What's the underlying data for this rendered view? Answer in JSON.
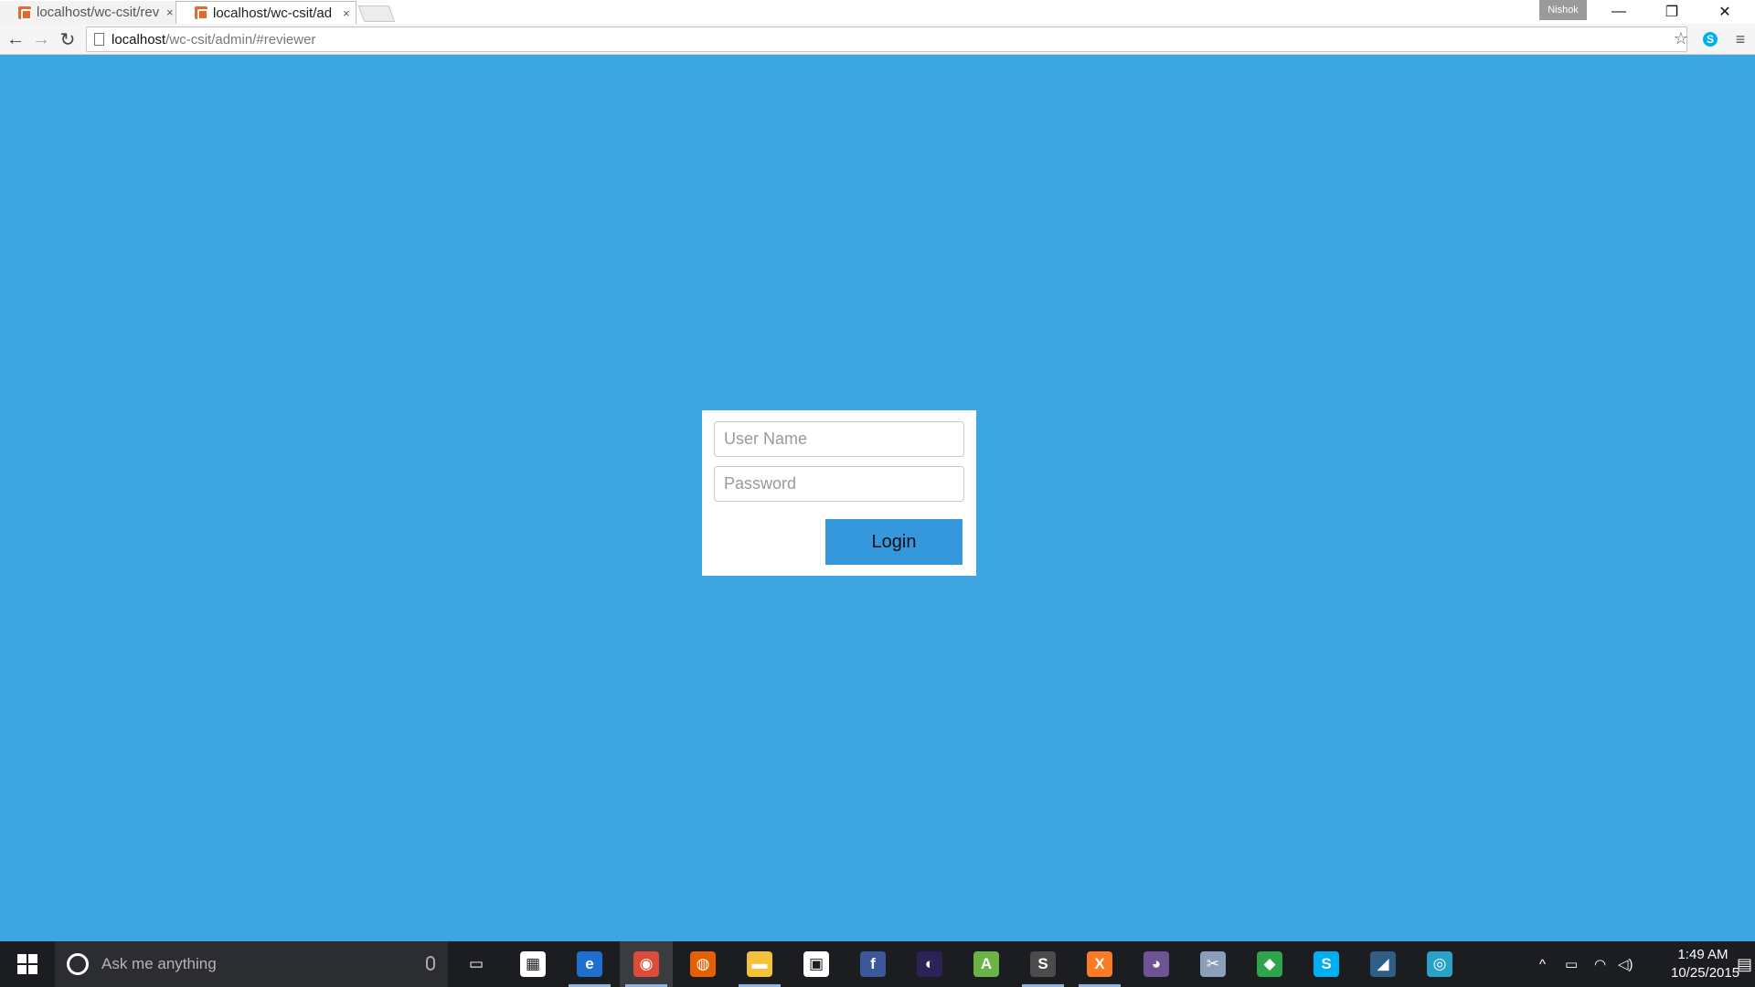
{
  "browser": {
    "tabs": [
      {
        "title": "localhost/wc-csit/rev",
        "active": false
      },
      {
        "title": "localhost/wc-csit/ad",
        "active": true
      }
    ],
    "tab_close_glyph": "×",
    "profile_name": "Nishok",
    "window_controls": {
      "minimize": "—",
      "restore": "❐",
      "close": "✕"
    },
    "url_host": "localhost",
    "url_path": "/wc-csit/admin/#reviewer",
    "nav": {
      "back": "←",
      "forward": "→",
      "reload": "↻"
    },
    "toolbar_glyphs": {
      "star": "☆",
      "skype": "S",
      "menu": "≡"
    }
  },
  "login": {
    "username_placeholder": "User Name",
    "password_placeholder": "Password",
    "button_label": "Login"
  },
  "colors": {
    "page_background": "#3ca5e2",
    "button_background": "#3598dc",
    "taskbar": "#1b1d21"
  },
  "taskbar": {
    "search_placeholder": "Ask me anything",
    "pinned": [
      {
        "name": "task-view",
        "glyph": "▭",
        "color": "#1b1d21"
      },
      {
        "name": "apps",
        "glyph": "▦",
        "color": "#ffffff"
      },
      {
        "name": "edge",
        "glyph": "e",
        "color": "#1f6fd1"
      },
      {
        "name": "chrome",
        "glyph": "◉",
        "color": "#dd4b39"
      },
      {
        "name": "firefox",
        "glyph": "◍",
        "color": "#e66000"
      },
      {
        "name": "file-explorer",
        "glyph": "▬",
        "color": "#f3c13a"
      },
      {
        "name": "store",
        "glyph": "▣",
        "color": "#ffffff"
      },
      {
        "name": "facebook",
        "glyph": "f",
        "color": "#3b5998"
      },
      {
        "name": "eclipse",
        "glyph": "◐",
        "color": "#2c2255"
      },
      {
        "name": "android-studio",
        "glyph": "A",
        "color": "#6ab344"
      },
      {
        "name": "sublime-text",
        "glyph": "S",
        "color": "#4b4b4b"
      },
      {
        "name": "xampp",
        "glyph": "X",
        "color": "#fb7a24"
      },
      {
        "name": "github",
        "glyph": "◕",
        "color": "#6e5494"
      },
      {
        "name": "snipping-tool",
        "glyph": "✂",
        "color": "#8aa0b8"
      },
      {
        "name": "fences",
        "glyph": "◆",
        "color": "#2ea44f"
      },
      {
        "name": "skype",
        "glyph": "S",
        "color": "#00aff0"
      },
      {
        "name": "mysql-workbench",
        "glyph": "◢",
        "color": "#2f5f86"
      },
      {
        "name": "app-globe",
        "glyph": "◎",
        "color": "#2aa1c7"
      }
    ],
    "tray": {
      "chevron": "^",
      "battery": "▭",
      "wifi": "◠",
      "volume": "◁)",
      "notifications": "▤"
    },
    "time": "1:49 AM",
    "date": "10/25/2015"
  }
}
